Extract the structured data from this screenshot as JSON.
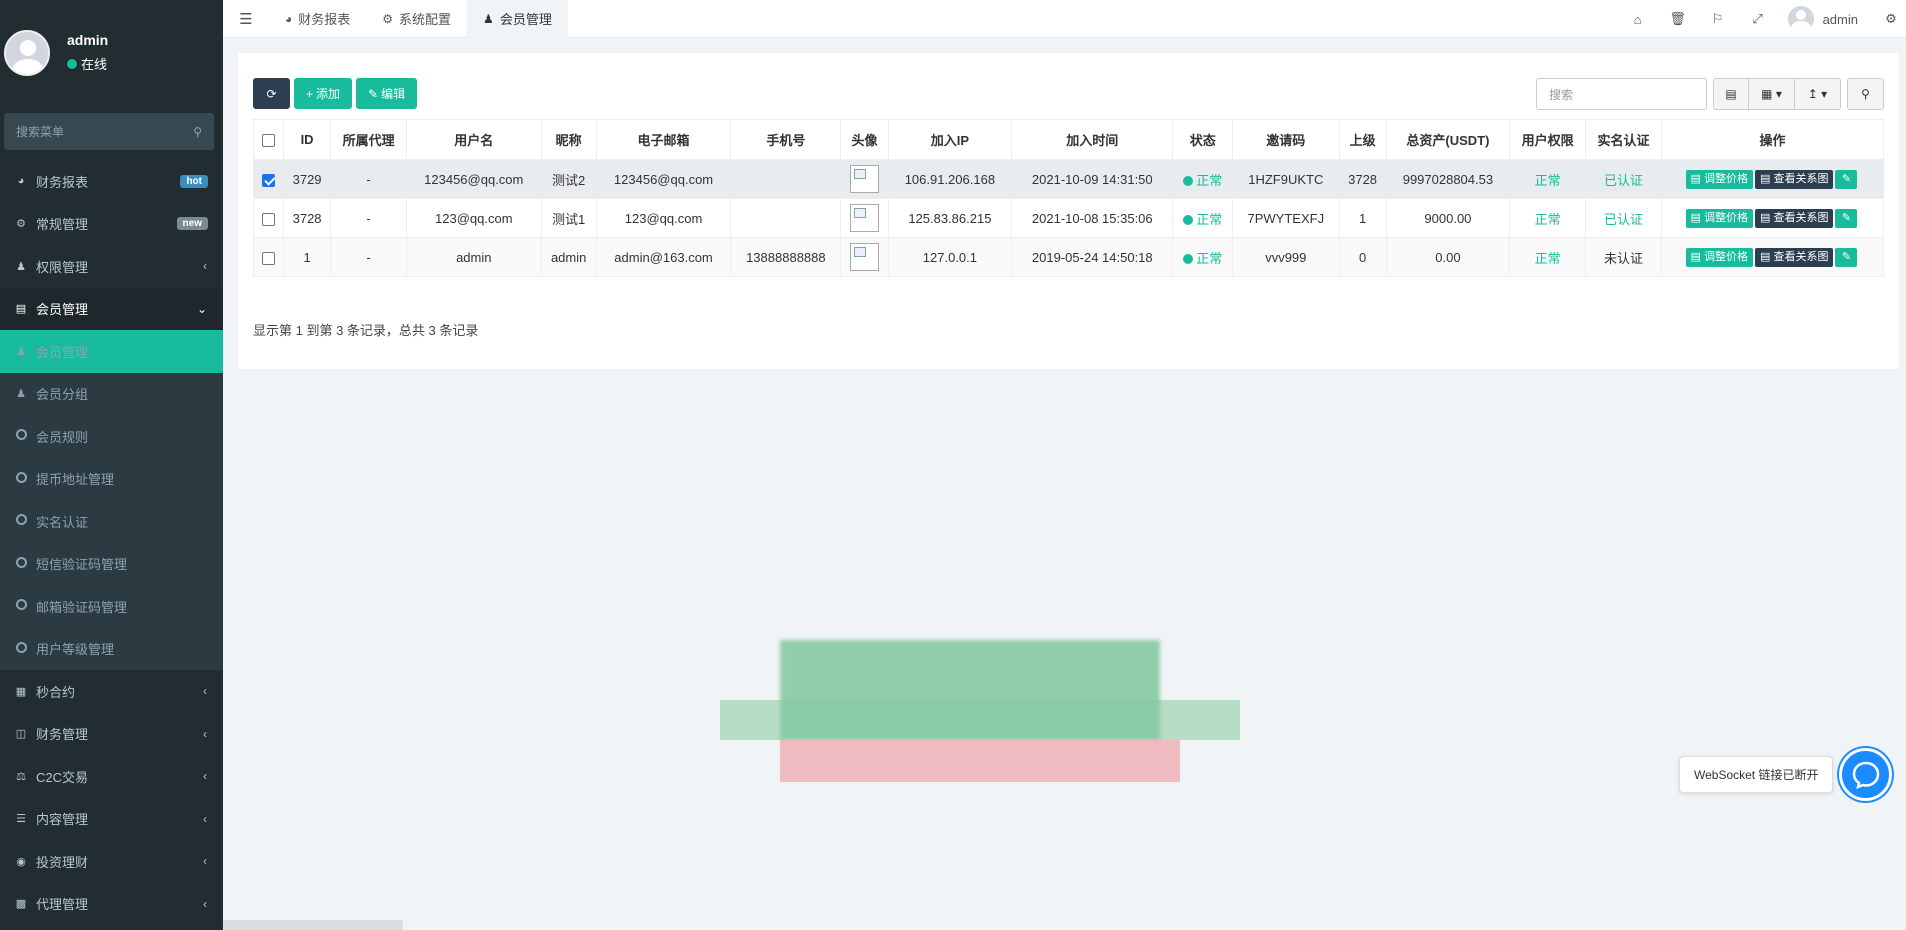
{
  "sidebar": {
    "user": {
      "name": "admin",
      "status": "在线"
    },
    "search_placeholder": "搜索菜单",
    "items": [
      {
        "label": "财务报表",
        "icon": "dashboard-icon",
        "badge": "hot"
      },
      {
        "label": "常规管理",
        "icon": "cogs-icon",
        "badge": "new"
      },
      {
        "label": "权限管理",
        "icon": "users-icon",
        "arrow": "‹"
      },
      {
        "label": "会员管理",
        "icon": "list-icon",
        "arrow": "⌄"
      }
    ],
    "submenu": [
      {
        "label": "会员管理",
        "icon": "user-icon"
      },
      {
        "label": "会员分组",
        "icon": "users-icon"
      },
      {
        "label": "会员规则",
        "icon": "circle-icon"
      },
      {
        "label": "提币地址管理",
        "icon": "circle-icon"
      },
      {
        "label": "实名认证",
        "icon": "circle-icon"
      },
      {
        "label": "短信验证码管理",
        "icon": "circle-icon"
      },
      {
        "label": "邮箱验证码管理",
        "icon": "circle-icon"
      },
      {
        "label": "用户等级管理",
        "icon": "circle-icon"
      }
    ],
    "items_after": [
      {
        "label": "秒合约",
        "icon": "calendar-icon"
      },
      {
        "label": "财务管理",
        "icon": "database-icon"
      },
      {
        "label": "C2C交易",
        "icon": "balance-icon"
      },
      {
        "label": "内容管理",
        "icon": "file-icon"
      },
      {
        "label": "投资理财",
        "icon": "compass-icon"
      },
      {
        "label": "代理管理",
        "icon": "briefcase-icon"
      }
    ]
  },
  "topbar": {
    "tabs": [
      {
        "label": "财务报表",
        "icon": "dashboard-icon"
      },
      {
        "label": "系统配置",
        "icon": "cog-icon"
      },
      {
        "label": "会员管理",
        "icon": "user-icon"
      }
    ],
    "user_name": "admin"
  },
  "toolbar": {
    "add_label": "添加",
    "edit_label": "编辑",
    "search_placeholder": "搜索"
  },
  "table": {
    "headers": [
      "ID",
      "所属代理",
      "用户名",
      "昵称",
      "电子邮箱",
      "手机号",
      "头像",
      "加入IP",
      "加入时间",
      "状态",
      "邀请码",
      "上级",
      "总资产(USDT)",
      "用户权限",
      "实名认证",
      "操作"
    ],
    "rows": [
      {
        "id": "3729",
        "agent": "-",
        "username": "123456@qq.com",
        "nickname": "测试2",
        "email": "123456@qq.com",
        "phone": "",
        "ip": "106.91.206.168",
        "time": "2021-10-09 14:31:50",
        "status": "正常",
        "invite": "1HZF9UKTC",
        "parent": "3728",
        "assets": "9997028804.53",
        "permission": "正常",
        "realname": "已认证",
        "selected": true
      },
      {
        "id": "3728",
        "agent": "-",
        "username": "123@qq.com",
        "nickname": "测试1",
        "email": "123@qq.com",
        "phone": "",
        "ip": "125.83.86.215",
        "time": "2021-10-08 15:35:06",
        "status": "正常",
        "invite": "7PWYTEXFJ",
        "parent": "1",
        "assets": "9000.00",
        "permission": "正常",
        "realname": "已认证",
        "selected": false
      },
      {
        "id": "1",
        "agent": "-",
        "username": "admin",
        "nickname": "admin",
        "email": "admin@163.com",
        "phone": "13888888888",
        "ip": "127.0.0.1",
        "time": "2019-05-24 14:50:18",
        "status": "正常",
        "invite": "vvv999",
        "parent": "0",
        "assets": "0.00",
        "permission": "正常",
        "realname": "未认证",
        "selected": false
      }
    ],
    "op_adjust": "调整价格",
    "op_relation": "查看关系图"
  },
  "page_info": "显示第 1 到第 3 条记录，总共 3 条记录",
  "websocket": {
    "text": "WebSocket 链接已断开"
  },
  "colors": {
    "accent": "#18bc9c",
    "sidebar": "#222d32",
    "dark_button": "#2c3e50",
    "bubble": "#1a8cff"
  }
}
